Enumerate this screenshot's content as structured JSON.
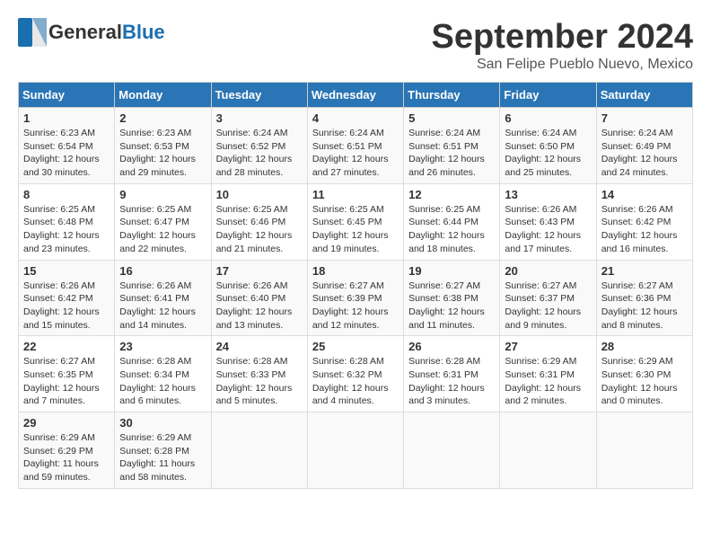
{
  "logo": {
    "general": "General",
    "blue": "Blue"
  },
  "title": "September 2024",
  "location": "San Felipe Pueblo Nuevo, Mexico",
  "days_of_week": [
    "Sunday",
    "Monday",
    "Tuesday",
    "Wednesday",
    "Thursday",
    "Friday",
    "Saturday"
  ],
  "weeks": [
    [
      {
        "day": "1",
        "info": "Sunrise: 6:23 AM\nSunset: 6:54 PM\nDaylight: 12 hours\nand 30 minutes."
      },
      {
        "day": "2",
        "info": "Sunrise: 6:23 AM\nSunset: 6:53 PM\nDaylight: 12 hours\nand 29 minutes."
      },
      {
        "day": "3",
        "info": "Sunrise: 6:24 AM\nSunset: 6:52 PM\nDaylight: 12 hours\nand 28 minutes."
      },
      {
        "day": "4",
        "info": "Sunrise: 6:24 AM\nSunset: 6:51 PM\nDaylight: 12 hours\nand 27 minutes."
      },
      {
        "day": "5",
        "info": "Sunrise: 6:24 AM\nSunset: 6:51 PM\nDaylight: 12 hours\nand 26 minutes."
      },
      {
        "day": "6",
        "info": "Sunrise: 6:24 AM\nSunset: 6:50 PM\nDaylight: 12 hours\nand 25 minutes."
      },
      {
        "day": "7",
        "info": "Sunrise: 6:24 AM\nSunset: 6:49 PM\nDaylight: 12 hours\nand 24 minutes."
      }
    ],
    [
      {
        "day": "8",
        "info": "Sunrise: 6:25 AM\nSunset: 6:48 PM\nDaylight: 12 hours\nand 23 minutes."
      },
      {
        "day": "9",
        "info": "Sunrise: 6:25 AM\nSunset: 6:47 PM\nDaylight: 12 hours\nand 22 minutes."
      },
      {
        "day": "10",
        "info": "Sunrise: 6:25 AM\nSunset: 6:46 PM\nDaylight: 12 hours\nand 21 minutes."
      },
      {
        "day": "11",
        "info": "Sunrise: 6:25 AM\nSunset: 6:45 PM\nDaylight: 12 hours\nand 19 minutes."
      },
      {
        "day": "12",
        "info": "Sunrise: 6:25 AM\nSunset: 6:44 PM\nDaylight: 12 hours\nand 18 minutes."
      },
      {
        "day": "13",
        "info": "Sunrise: 6:26 AM\nSunset: 6:43 PM\nDaylight: 12 hours\nand 17 minutes."
      },
      {
        "day": "14",
        "info": "Sunrise: 6:26 AM\nSunset: 6:42 PM\nDaylight: 12 hours\nand 16 minutes."
      }
    ],
    [
      {
        "day": "15",
        "info": "Sunrise: 6:26 AM\nSunset: 6:42 PM\nDaylight: 12 hours\nand 15 minutes."
      },
      {
        "day": "16",
        "info": "Sunrise: 6:26 AM\nSunset: 6:41 PM\nDaylight: 12 hours\nand 14 minutes."
      },
      {
        "day": "17",
        "info": "Sunrise: 6:26 AM\nSunset: 6:40 PM\nDaylight: 12 hours\nand 13 minutes."
      },
      {
        "day": "18",
        "info": "Sunrise: 6:27 AM\nSunset: 6:39 PM\nDaylight: 12 hours\nand 12 minutes."
      },
      {
        "day": "19",
        "info": "Sunrise: 6:27 AM\nSunset: 6:38 PM\nDaylight: 12 hours\nand 11 minutes."
      },
      {
        "day": "20",
        "info": "Sunrise: 6:27 AM\nSunset: 6:37 PM\nDaylight: 12 hours\nand 9 minutes."
      },
      {
        "day": "21",
        "info": "Sunrise: 6:27 AM\nSunset: 6:36 PM\nDaylight: 12 hours\nand 8 minutes."
      }
    ],
    [
      {
        "day": "22",
        "info": "Sunrise: 6:27 AM\nSunset: 6:35 PM\nDaylight: 12 hours\nand 7 minutes."
      },
      {
        "day": "23",
        "info": "Sunrise: 6:28 AM\nSunset: 6:34 PM\nDaylight: 12 hours\nand 6 minutes."
      },
      {
        "day": "24",
        "info": "Sunrise: 6:28 AM\nSunset: 6:33 PM\nDaylight: 12 hours\nand 5 minutes."
      },
      {
        "day": "25",
        "info": "Sunrise: 6:28 AM\nSunset: 6:32 PM\nDaylight: 12 hours\nand 4 minutes."
      },
      {
        "day": "26",
        "info": "Sunrise: 6:28 AM\nSunset: 6:31 PM\nDaylight: 12 hours\nand 3 minutes."
      },
      {
        "day": "27",
        "info": "Sunrise: 6:29 AM\nSunset: 6:31 PM\nDaylight: 12 hours\nand 2 minutes."
      },
      {
        "day": "28",
        "info": "Sunrise: 6:29 AM\nSunset: 6:30 PM\nDaylight: 12 hours\nand 0 minutes."
      }
    ],
    [
      {
        "day": "29",
        "info": "Sunrise: 6:29 AM\nSunset: 6:29 PM\nDaylight: 11 hours\nand 59 minutes."
      },
      {
        "day": "30",
        "info": "Sunrise: 6:29 AM\nSunset: 6:28 PM\nDaylight: 11 hours\nand 58 minutes."
      },
      {
        "day": "",
        "info": ""
      },
      {
        "day": "",
        "info": ""
      },
      {
        "day": "",
        "info": ""
      },
      {
        "day": "",
        "info": ""
      },
      {
        "day": "",
        "info": ""
      }
    ]
  ]
}
